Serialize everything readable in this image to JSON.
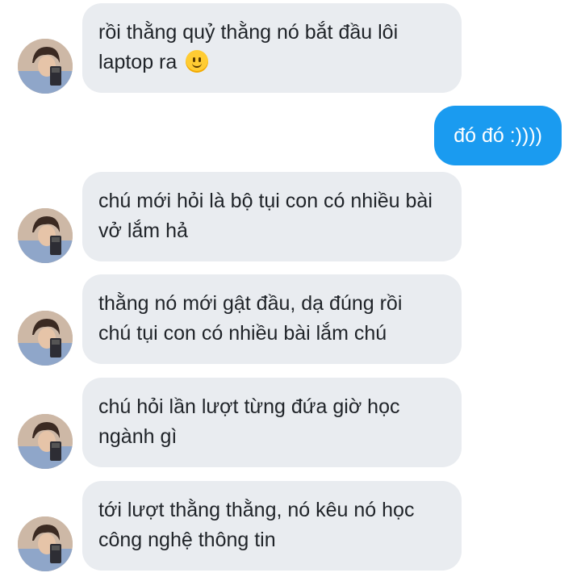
{
  "messages": [
    {
      "direction": "incoming",
      "lines": [
        "rồi thằng quỷ thằng nó bắt đầu lôi",
        "laptop ra"
      ],
      "emoji": "slightly-smiling-face-icon"
    },
    {
      "direction": "outgoing",
      "text": "đó đó :))))"
    },
    {
      "direction": "incoming",
      "lines": [
        "chú mới hỏi là bộ tụi con có nhiều bài",
        "vở lắm hả"
      ]
    },
    {
      "direction": "incoming",
      "lines": [
        "thằng nó mới gật đầu, dạ đúng rồi",
        "chú tụi con có nhiều bài lắm chú"
      ]
    },
    {
      "direction": "incoming",
      "lines": [
        "chú hỏi lần lượt từng đứa giờ học",
        "ngành gì"
      ]
    },
    {
      "direction": "incoming",
      "lines": [
        "tới lượt thằng thằng, nó kêu nó học",
        "công nghệ thông tin"
      ]
    }
  ],
  "colors": {
    "incoming_bubble": "#e9ecf0",
    "outgoing_bubble": "#1a9bf0",
    "incoming_text": "#1f2328",
    "outgoing_text": "#ffffff"
  }
}
